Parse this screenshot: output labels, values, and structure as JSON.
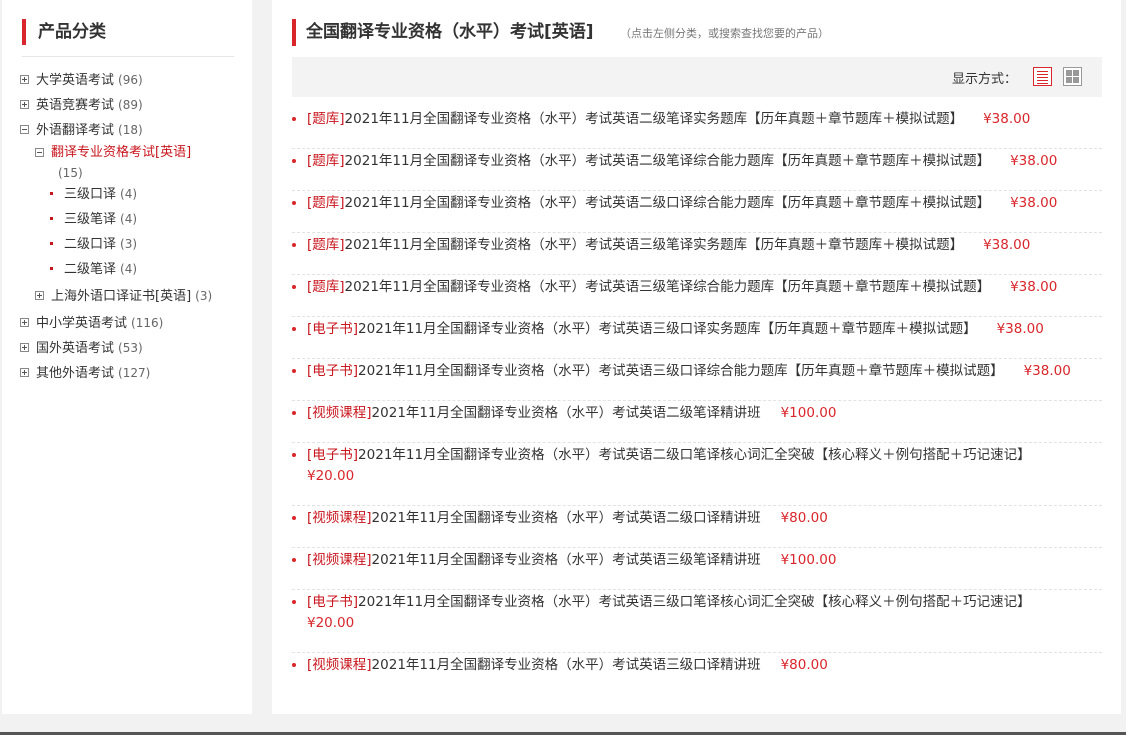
{
  "sidebar": {
    "title": "产品分类",
    "tree": [
      {
        "label": "大学英语考试",
        "count": "(96)",
        "toggle": "plus"
      },
      {
        "label": "英语竞赛考试",
        "count": "(89)",
        "toggle": "plus"
      },
      {
        "label": "外语翻译考试",
        "count": "(18)",
        "toggle": "minus"
      },
      {
        "label": "翻译专业资格考试[英语]",
        "count": "(15)",
        "toggle": "minus",
        "active": true
      },
      {
        "label": "三级口译",
        "count": "(4)"
      },
      {
        "label": "三级笔译",
        "count": "(4)"
      },
      {
        "label": "二级口译",
        "count": "(3)"
      },
      {
        "label": "二级笔译",
        "count": "(4)"
      },
      {
        "label": "上海外语口译证书[英语]",
        "count": "(3)",
        "toggle": "plus"
      },
      {
        "label": "中小学英语考试",
        "count": "(116)",
        "toggle": "plus"
      },
      {
        "label": "国外英语考试",
        "count": "(53)",
        "toggle": "plus"
      },
      {
        "label": "其他外语考试",
        "count": "(127)",
        "toggle": "plus"
      }
    ]
  },
  "main": {
    "title": "全国翻译专业资格（水平）考试[英语]",
    "hint": "（点击左侧分类，或搜索查找您要的产品）",
    "display_label": "显示方式：",
    "products": [
      {
        "tag": "[题库]",
        "name": "2021年11月全国翻译专业资格（水平）考试英语二级笔译实务题库【历年真题＋章节题库＋模拟试题】",
        "price": "¥38.00"
      },
      {
        "tag": "[题库]",
        "name": "2021年11月全国翻译专业资格（水平）考试英语二级笔译综合能力题库【历年真题＋章节题库＋模拟试题】",
        "price": "¥38.00"
      },
      {
        "tag": "[题库]",
        "name": "2021年11月全国翻译专业资格（水平）考试英语二级口译综合能力题库【历年真题＋章节题库＋模拟试题】",
        "price": "¥38.00"
      },
      {
        "tag": "[题库]",
        "name": "2021年11月全国翻译专业资格（水平）考试英语三级笔译实务题库【历年真题＋章节题库＋模拟试题】",
        "price": "¥38.00"
      },
      {
        "tag": "[题库]",
        "name": "2021年11月全国翻译专业资格（水平）考试英语三级笔译综合能力题库【历年真题＋章节题库＋模拟试题】",
        "price": "¥38.00"
      },
      {
        "tag": "[电子书]",
        "name": "2021年11月全国翻译专业资格（水平）考试英语三级口译实务题库【历年真题＋章节题库＋模拟试题】",
        "price": "¥38.00"
      },
      {
        "tag": "[电子书]",
        "name": "2021年11月全国翻译专业资格（水平）考试英语三级口译综合能力题库【历年真题＋章节题库＋模拟试题】",
        "price": "¥38.00"
      },
      {
        "tag": "[视频课程]",
        "name": "2021年11月全国翻译专业资格（水平）考试英语二级笔译精讲班",
        "price": "¥100.00"
      },
      {
        "tag": "[电子书]",
        "name": "2021年11月全国翻译专业资格（水平）考试英语二级口笔译核心词汇全突破【核心释义＋例句搭配＋巧记速记】",
        "price": "¥20.00"
      },
      {
        "tag": "[视频课程]",
        "name": "2021年11月全国翻译专业资格（水平）考试英语二级口译精讲班",
        "price": "¥80.00"
      },
      {
        "tag": "[视频课程]",
        "name": "2021年11月全国翻译专业资格（水平）考试英语三级笔译精讲班",
        "price": "¥100.00"
      },
      {
        "tag": "[电子书]",
        "name": "2021年11月全国翻译专业资格（水平）考试英语三级口笔译核心词汇全突破【核心释义＋例句搭配＋巧记速记】",
        "price": "¥20.00"
      },
      {
        "tag": "[视频课程]",
        "name": "2021年11月全国翻译专业资格（水平）考试英语三级口译精讲班",
        "price": "¥80.00"
      }
    ]
  },
  "colors": {
    "accent": "#d9262b",
    "tag": "#c8161d",
    "toolbar_bg": "#f3f3f3"
  },
  "icons": {
    "list_view": "list-view-icon",
    "grid_view": "grid-view-icon"
  }
}
